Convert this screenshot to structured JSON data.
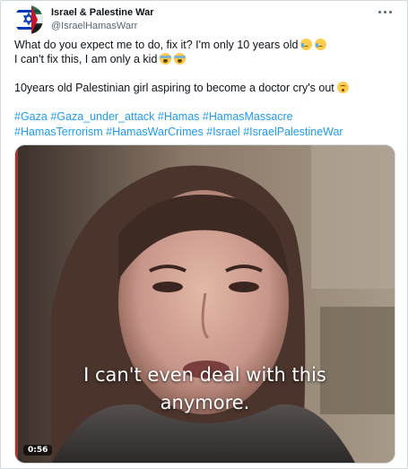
{
  "account": {
    "display_name": "Israel & Palestine War",
    "handle": "@IsraelHamasWarr",
    "avatar_icon": "israel-flag-avatar-icon"
  },
  "menu": {
    "icon": "more-horizontal-icon"
  },
  "tweet": {
    "line1": "What do you expect me to do, fix it? I'm only 10 years old",
    "line2": "I can't fix this, I am only a kid",
    "line3": "10years old Palestinian girl aspiring to become a doctor cry's out",
    "hashtags_row1": [
      "#Gaza",
      "#Gaza_under_attack",
      "#Hamas",
      "#HamasMassacre"
    ],
    "hashtags_row2": [
      "#HamasTerrorism",
      "#HamasWarCrimes",
      "#Israel",
      "#IsraelPalestineWar"
    ]
  },
  "video": {
    "caption_line1": "I can't even deal with this",
    "caption_line2": "anymore.",
    "duration": "0:56"
  },
  "colors": {
    "link": "#1d9bf0",
    "text": "#0f1419",
    "muted": "#536471",
    "border": "#cfd9de"
  }
}
